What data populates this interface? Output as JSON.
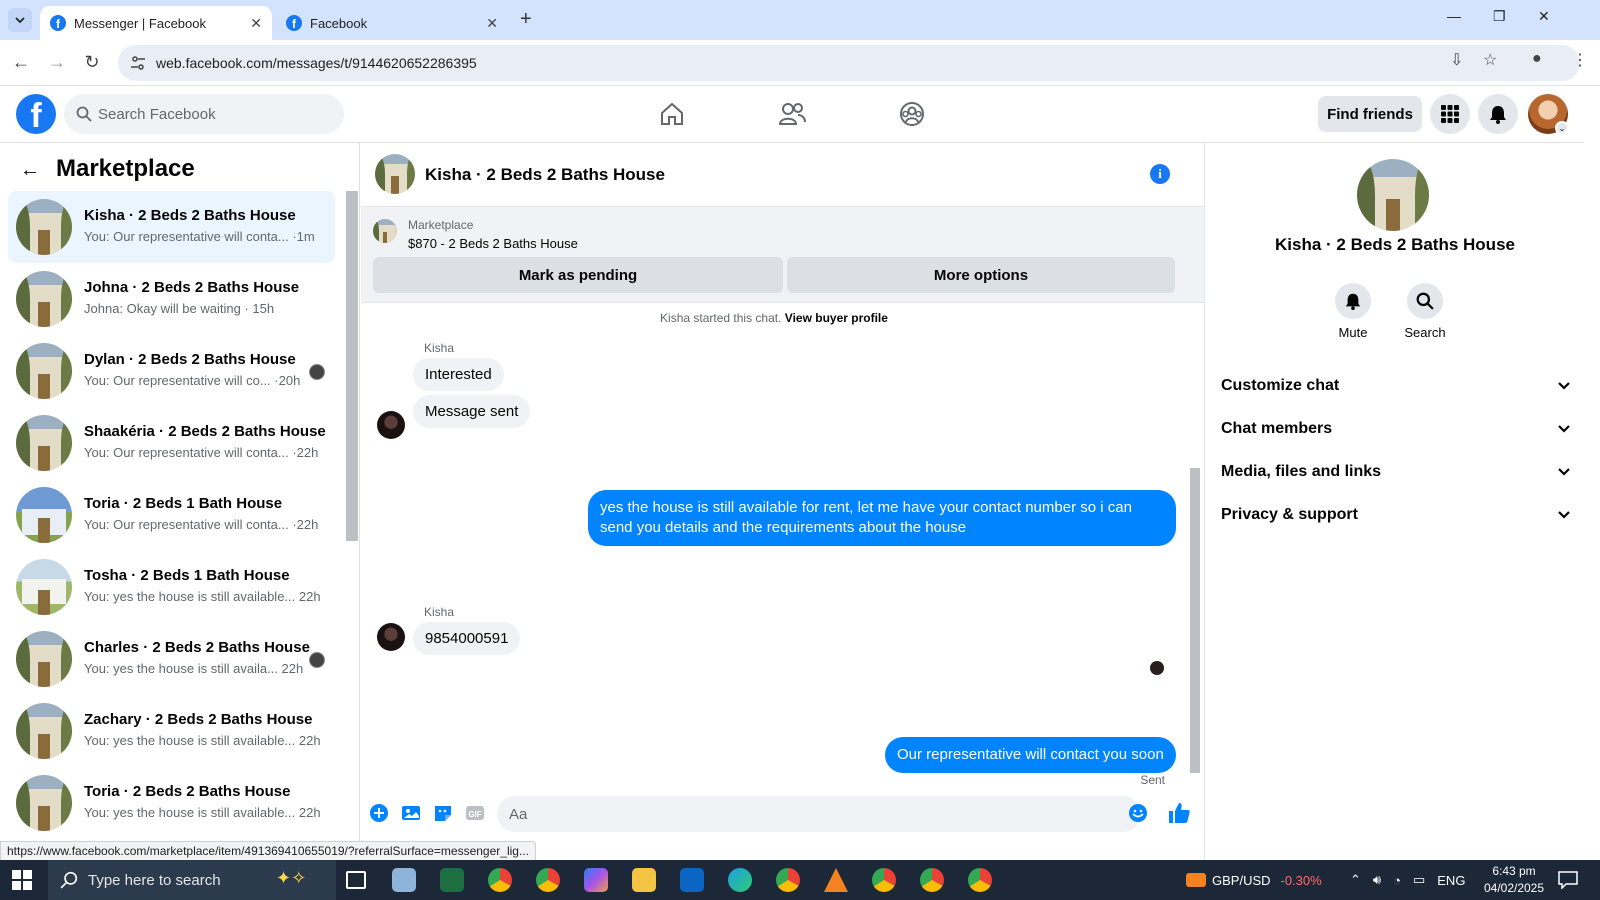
{
  "browser": {
    "tabs": [
      {
        "title": "Messenger | Facebook",
        "active": true
      },
      {
        "title": "Facebook",
        "active": false
      }
    ],
    "url": "web.facebook.com/messages/t/9144620652286395",
    "status_url": "https://www.facebook.com/marketplace/item/491369410655019/?referralSurface=messenger_lig..."
  },
  "fb_header": {
    "search_placeholder": "Search Facebook",
    "find_friends": "Find friends"
  },
  "sidebar": {
    "title": "Marketplace",
    "conversations": [
      {
        "name": "Kisha · 2 Beds 2 Baths House",
        "preview": "You: Our representative will conta... ·1m",
        "active": true,
        "thumb": "house"
      },
      {
        "name": "Johna · 2 Beds 2 Baths House",
        "preview": "Johna: Okay will be waiting · 15h",
        "active": false,
        "thumb": "house"
      },
      {
        "name": "Dylan · 2 Beds 2 Baths House",
        "preview": "You: Our representative will co... ·20h",
        "active": false,
        "thumb": "house",
        "seen": true
      },
      {
        "name": "Shaakéria · 2 Beds 2 Baths House",
        "preview": "You: Our representative will conta... ·22h",
        "active": false,
        "thumb": "house"
      },
      {
        "name": "Toria · 2 Beds 1 Bath House",
        "preview": "You: Our representative will conta... ·22h",
        "active": false,
        "thumb": "blue"
      },
      {
        "name": "Tosha · 2 Beds 1 Bath House",
        "preview": "You: yes the house is still available... 22h",
        "active": false,
        "thumb": "white"
      },
      {
        "name": "Charles · 2 Beds 2 Baths House",
        "preview": "You: yes the house is still availa... 22h",
        "active": false,
        "thumb": "house",
        "seen": true
      },
      {
        "name": "Zachary · 2 Beds 2 Baths House",
        "preview": "You: yes the house is still available... 22h",
        "active": false,
        "thumb": "house"
      },
      {
        "name": "Toria · 2 Beds 2 Baths House",
        "preview": "You: yes the house is still available... 22h",
        "active": false,
        "thumb": "house"
      }
    ]
  },
  "chat": {
    "title": "Kisha · 2 Beds 2 Baths House",
    "marketplace_label": "Marketplace",
    "listing": "$870 - 2 Beds 2 Baths House",
    "mark_pending": "Mark as pending",
    "more_options": "More options",
    "started_text": "Kisha started this chat.",
    "view_profile": "View buyer profile",
    "messages": {
      "sender1": "Kisha",
      "in1": "Interested",
      "in2": "Message sent",
      "out1": "yes the house is still available for rent, let me have your contact number so i can send you details and the requirements about the house",
      "sender2": "Kisha",
      "in3": "9854000591",
      "out2": "Our representative will contact you soon",
      "sent_label": "Sent"
    },
    "composer_placeholder": "Aa"
  },
  "right_panel": {
    "name": "Kisha · 2 Beds 2 Baths House",
    "mute": "Mute",
    "search": "Search",
    "sections": [
      "Customize chat",
      "Chat members",
      "Media, files and links",
      "Privacy & support"
    ]
  },
  "taskbar": {
    "search_placeholder": "Type here to search",
    "ticker": "GBP/USD",
    "ticker_change": "-0.30%",
    "language": "ENG",
    "time": "6:43 pm",
    "date": "04/02/2025"
  },
  "colors": {
    "fb_blue": "#1877f2",
    "messenger_blue": "#0084ff",
    "ticker_negative": "#ff6b6b"
  }
}
